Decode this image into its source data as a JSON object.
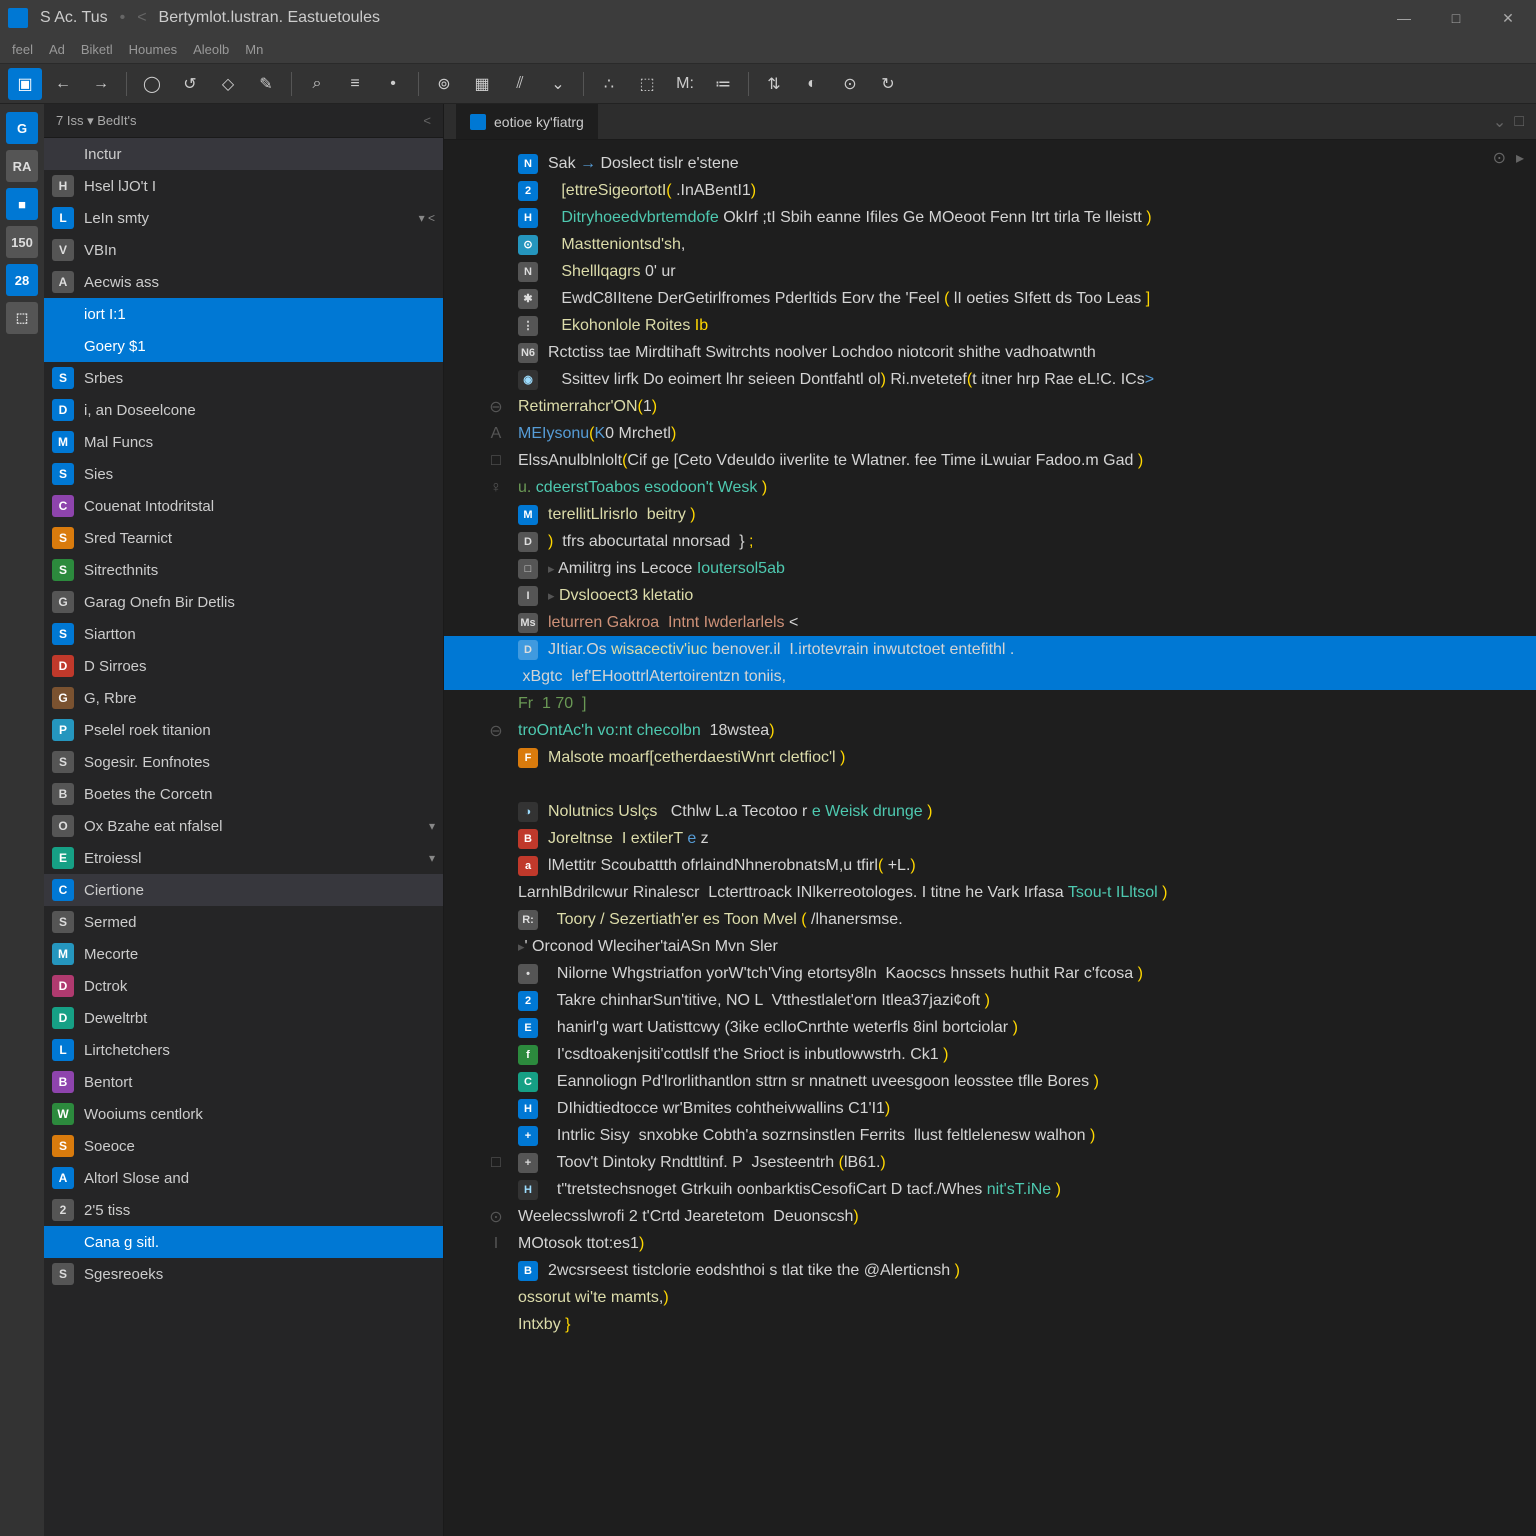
{
  "titlebar": {
    "app": "S  Ac. Tus",
    "doc": "Bertymlot.lustran. Eastuetoules"
  },
  "winbuttons": {
    "min": "—",
    "max": "□",
    "close": "✕"
  },
  "menubar": [
    "feel",
    "Ad",
    "Biketl",
    "Houmes",
    "Aleolb",
    "Mn"
  ],
  "toolbar_icons": [
    "▣",
    "←",
    "→",
    "◯",
    "↺",
    "◇",
    "✎",
    "⌕",
    "≡",
    "•",
    "⊚",
    "▦",
    "⫽",
    "⌄",
    "∴",
    "⬚",
    "M:",
    "≔",
    "⇅",
    "◐",
    "⊙",
    "↻"
  ],
  "sidecol": [
    {
      "t": "G",
      "c": "c-blue"
    },
    {
      "t": "RA",
      "c": "c-gray"
    },
    {
      "t": "■",
      "c": "c-blue"
    },
    {
      "t": "150",
      "c": "c-gray"
    },
    {
      "t": "28",
      "c": "c-blue"
    },
    {
      "t": "⬚",
      "c": "c-gray"
    }
  ],
  "sidebar": {
    "header": "7 Iss  ▾  BedIt's",
    "items": [
      {
        "ic": "",
        "c": "",
        "t": "Inctur",
        "hl": true
      },
      {
        "ic": "H",
        "c": "c-gray",
        "t": "Hsel lJO't I"
      },
      {
        "ic": "L",
        "c": "c-blue",
        "t": "LeIn smty",
        "badge": "▾   <"
      },
      {
        "ic": "V",
        "c": "c-gray",
        "t": "VBIn"
      },
      {
        "ic": "A",
        "c": "c-gray",
        "t": "Aecwis ass"
      },
      {
        "ic": "",
        "c": "",
        "t": "iort I:1",
        "sel": true
      },
      {
        "ic": "",
        "c": "",
        "t": "Goery $1",
        "sel": true
      },
      {
        "ic": "S",
        "c": "c-blue",
        "t": "Srbes"
      },
      {
        "ic": "D",
        "c": "c-blue",
        "t": "i, an Doseelcone"
      },
      {
        "ic": "M",
        "c": "c-blue",
        "t": "Mal Funcs"
      },
      {
        "ic": "S",
        "c": "c-blue",
        "t": "Sies"
      },
      {
        "ic": "C",
        "c": "c-purple",
        "t": "Couenat Intodritstal"
      },
      {
        "ic": "S",
        "c": "c-orange",
        "t": "Sred Tearnict"
      },
      {
        "ic": "S",
        "c": "c-green",
        "t": "Sitrecthnits"
      },
      {
        "ic": "G",
        "c": "c-gray",
        "t": "Garag Onefn Bir Detlis"
      },
      {
        "ic": "S",
        "c": "c-blue",
        "t": "Siartton"
      },
      {
        "ic": "D",
        "c": "c-red",
        "t": "D Sirroes"
      },
      {
        "ic": "G",
        "c": "c-brown",
        "t": "G, Rbre"
      },
      {
        "ic": "P",
        "c": "c-cyan",
        "t": "Pselel roek titanion"
      },
      {
        "ic": "S",
        "c": "c-gray",
        "t": "Sogesir. Eonfnotes"
      },
      {
        "ic": "B",
        "c": "c-gray",
        "t": "Boetes the Corcetn"
      },
      {
        "ic": "O",
        "c": "c-gray",
        "t": "Ox Bzahe eat nfalsel",
        "badge": "▾"
      },
      {
        "ic": "E",
        "c": "c-teal",
        "t": "Etroiessl",
        "badge": "▾"
      },
      {
        "ic": "C",
        "c": "c-blue",
        "t": "Ciertione",
        "hl": true
      },
      {
        "ic": "S",
        "c": "c-gray",
        "t": "Sermed"
      },
      {
        "ic": "M",
        "c": "c-cyan",
        "t": "Mecorte"
      },
      {
        "ic": "D",
        "c": "c-pink",
        "t": "Dctrok"
      },
      {
        "ic": "D",
        "c": "c-teal",
        "t": "Deweltrbt"
      },
      {
        "ic": "L",
        "c": "c-blue",
        "t": "Lirtchetchers"
      },
      {
        "ic": "B",
        "c": "c-purple",
        "t": "Bentort"
      },
      {
        "ic": "W",
        "c": "c-green",
        "t": "Wooiums centlork"
      },
      {
        "ic": "S",
        "c": "c-orange",
        "t": "Soeoce"
      },
      {
        "ic": "A",
        "c": "c-blue",
        "t": "Altorl Slose and"
      },
      {
        "ic": "2",
        "c": "c-gray",
        "t": "2'5 tiss"
      },
      {
        "ic": "",
        "c": "",
        "t": "Cana g sitl.",
        "sel": true
      },
      {
        "ic": "S",
        "c": "c-gray",
        "t": "Sgesreoeks"
      }
    ]
  },
  "tab": {
    "label": "eotioe ky'fiatrg"
  },
  "doc": [
    {
      "g": "",
      "ic": "N",
      "c": "c-blue",
      "h": "Sak <span class='kw'>→</span> Doslect tislr e'stene"
    },
    {
      "g": "",
      "ic": "2",
      "c": "c-blue",
      "h": "   <span class='fn'>[ettreSigeortotI</span><span class='paren'>(</span> .InABentI1<span class='paren'>)</span>"
    },
    {
      "g": "",
      "ic": "H",
      "c": "c-blue",
      "h": "   <span class='type'>Ditryhoeedvbrtemdofe</span> OkIrf ;tI Sbih eanne Ifiles Ge MOeoot Fenn Itrt tirla Te lleistt <span class='paren'>)</span>"
    },
    {
      "g": "",
      "ic": "⊙",
      "c": "c-cyan",
      "h": "   <span class='fn'>Mastteniontsd'sh</span>,"
    },
    {
      "g": "",
      "ic": "N",
      "c": "c-gray",
      "h": "   <span class='fn'>Shelllqagrs</span> 0' ur"
    },
    {
      "g": "",
      "ic": "✱",
      "c": "c-gray",
      "h": "   EwdC8IItene DerGetirlfromes Pderltids Eorv the 'Feel <span class='paren'>(</span> lI oeties SIfett ds Too Leas <span class='paren'>]</span>"
    },
    {
      "g": "",
      "ic": "⋮",
      "c": "c-gray",
      "h": "   <span class='fn'>Ekohonlole Roites</span> <span class='paren'>Ib</span>"
    },
    {
      "g": "",
      "ic": "N6",
      "c": "",
      "h": "Rctctiss tae Mirdtihaft Switrchts noolver Lochdoo niotcorit shithe vadhoatwnth"
    },
    {
      "g": "",
      "ic": "◉",
      "c": "c-dk",
      "h": "   Ssittev lirfk Do eoimert lhr seieen Dontfahtl ol<span class='paren'>)</span> Ri.nvetetef<span class='paren'>(</span>t itner hrp Rae eL!C. ICs<span class='kw'>></span>"
    },
    {
      "g": "⊖",
      "ic": "",
      "c": "",
      "h": "<span class='fn'>Retimerrahcr'ON</span><span class='paren'>(</span>1<span class='paren'>)</span>"
    },
    {
      "g": "A",
      "ic": "",
      "c": "",
      "h": "<span class='kw'>MEIysonu</span><span class='paren'>(</span><span class='kw'>K</span>0 Mrchetl<span class='paren'>)</span>"
    },
    {
      "g": "□",
      "ic": "",
      "c": "",
      "h": "ElssAnulblnlolt<span class='paren'>(</span>Cif ge [Ceto Vdeuldo iiverlite te Wlatner. fee Time iLwuiar Fadoo.m Gad <span class='paren'>)</span>"
    },
    {
      "g": "♀",
      "ic": "",
      "c": "",
      "h": "<span class='cmt'>u.</span> <span class='type'>cdeerstToabos esodoon't Wesk</span> <span class='paren'>)</span>"
    },
    {
      "g": "",
      "ic": "M",
      "c": "c-blue",
      "h": "<span class='fn'>terellitLlrisrlo  beitry</span> <span class='paren'>)</span>"
    },
    {
      "g": "",
      "ic": "D",
      "c": "c-gray",
      "h": "<span class='paren'>)</span>  tfrs abocurtatal nnorsad  } <span class='paren'>;</span>"
    },
    {
      "g": "",
      "ic": "□",
      "c": "c-gray",
      "h": "<span class='fold'>▸</span> Amilitrg ins Lecoce <span class='type'>Ioutersol5ab</span>"
    },
    {
      "g": "",
      "ic": "I",
      "c": "",
      "h": "<span class='fold'>▸</span> <span class='fn'>Dvslooect3 kletatio</span>"
    },
    {
      "g": "",
      "ic": "Ms",
      "c": "",
      "h": "<span class='str'>leturren Gakroa  Intnt Iwderlarlels</span> <"
    },
    {
      "g": "",
      "ic": "D",
      "c": "",
      "h": "JItiar.Os <span class='fn'>wisacectiv'iuc</span> benover.il  I.irtotevrain inwutctoet entefithl .",
      "sel": true
    },
    {
      "g": "",
      "ic": "",
      "c": "",
      "h": " xBgtc  lef'EHoottrlAtertoirentzn toniis,",
      "sel": true
    },
    {
      "g": "",
      "ic": "",
      "c": "",
      "h": "<span class='cmt'>Fr  1 70  ]</span>"
    },
    {
      "g": "⊖",
      "ic": "",
      "c": "",
      "h": "<span class='type'>troOntAc'h vo:nt checolbn</span>  18wstea<span class='paren'>)</span>"
    },
    {
      "g": "",
      "ic": "F",
      "c": "c-orange",
      "h": "<span class='fn'>Malsote moarf[cetherdaestiWnrt cletfioc'l</span> <span class='paren'>)</span>"
    },
    {
      "g": "",
      "ic": "",
      "c": "",
      "h": " "
    },
    {
      "g": "",
      "ic": "◑",
      "c": "c-dk",
      "h": "<span class='fn'>Nolutnics Uslçs</span>   Cthlw L.a Tecotoo r <span class='type'>e Weisk drunge</span> <span class='paren'>)</span>"
    },
    {
      "g": "",
      "ic": "B",
      "c": "c-red",
      "h": "<span class='fn'>Joreltnse  I extilerT</span> <span class='kw'>e</span> z"
    },
    {
      "g": "",
      "ic": "a",
      "c": "c-red",
      "h": "lMettitr Scoubattth ofrlaindNhnerobnatsM,u tfirl<span class='paren'>(</span> +L.<span class='paren'>)</span>"
    },
    {
      "g": "",
      "ic": "",
      "c": "",
      "h": "LarnhlBdrilcwur Rinalescr  Lcterttroack INlkerreotologes. I titne he Vark Irfasa <span class='type'>Tsou-t ILltsol</span> <span class='paren'>)</span>"
    },
    {
      "g": "",
      "ic": "R:",
      "c": "",
      "h": "  <span class='fn'>Toory / Sezertiath'er es Toon Mvel</span> <span class='paren'>(</span> /lhanersmse."
    },
    {
      "g": "",
      "ic": "",
      "c": "",
      "h": "<span class='fold'>▸</span>' Orconod Wleciher'taiASn Mvn Sler"
    },
    {
      "g": "",
      "ic": "•",
      "c": "",
      "h": "  Nilorne Whgstriatfon yorW'tch'Ving etortsy8ln  Kaocscs hnssets huthit Rar c'fcosa <span class='paren'>)</span>"
    },
    {
      "g": "",
      "ic": "2",
      "c": "c-blue",
      "h": "  Takre chinharSun'titive, NO L  Vtthestlalet'orn Itlea37jazi¢oft <span class='paren'>)</span>"
    },
    {
      "g": "",
      "ic": "E",
      "c": "c-blue",
      "h": "  hanirl'g wart Uatisttcwy (3ike eclloCnrthte weterfls 8inl bortciolar <span class='paren'>)</span>"
    },
    {
      "g": "",
      "ic": "f",
      "c": "c-green",
      "h": "  I'csdtoakenjsiti'cottlslf t'he Srioct is inbutlowwstrh. Ck1 <span class='paren'>)</span>"
    },
    {
      "g": "",
      "ic": "C",
      "c": "c-teal",
      "h": "  Eannoliogn Pd'lrorlithantlon sttrn sr nnatnett uveesgoon leosstee tflle Bores <span class='paren'>)</span>"
    },
    {
      "g": "",
      "ic": "H",
      "c": "c-blue",
      "h": "  DIhidtiedtocce wr'Bmites cohtheivwallins C1'I1<span class='paren'>)</span>"
    },
    {
      "g": "",
      "ic": "+",
      "c": "c-blue",
      "h": "  Intrlic Sisy  snxobke Cobth'a sozrnsinstlen Ferrits  llust feltlelenesw walhon <span class='paren'>)</span>"
    },
    {
      "g": "□",
      "ic": "+",
      "c": "c-gray",
      "h": "  Toov't Dintoky Rndttltinf. P  Jsesteentrh <span class='paren'>(</span>lB61.<span class='paren'>)</span>"
    },
    {
      "g": "",
      "ic": "H",
      "c": "c-dk",
      "h": "  t\"tretstechsnoget Gtrkuih oonbarktisCesofiCart D tacf./Whes <span class='type'>nit'sT.iNe</span> <span class='paren'>)</span>"
    },
    {
      "g": "⊙",
      "ic": "",
      "c": "",
      "h": "Weelecsslwrofi 2 t'Crtd Jearetetom  Deuonscsh<span class='paren'>)</span>"
    },
    {
      "g": "I",
      "ic": "",
      "c": "",
      "h": "MOtosok ttot:es1<span class='paren'>)</span>"
    },
    {
      "g": "",
      "ic": "B",
      "c": "c-blue",
      "h": "2wcsrseest tistclorie eodshthoi s tlat tike the @Alerticnsh <span class='paren'>)</span>"
    },
    {
      "g": "",
      "ic": "",
      "c": "",
      "h": "<span class='fn'>ossorut wi'te mamts</span>,<span class='paren'>)</span>"
    },
    {
      "g": "",
      "ic": "",
      "c": "",
      "h": "<span class='fn'>Intxby</span> <span class='paren'>}</span>"
    }
  ]
}
